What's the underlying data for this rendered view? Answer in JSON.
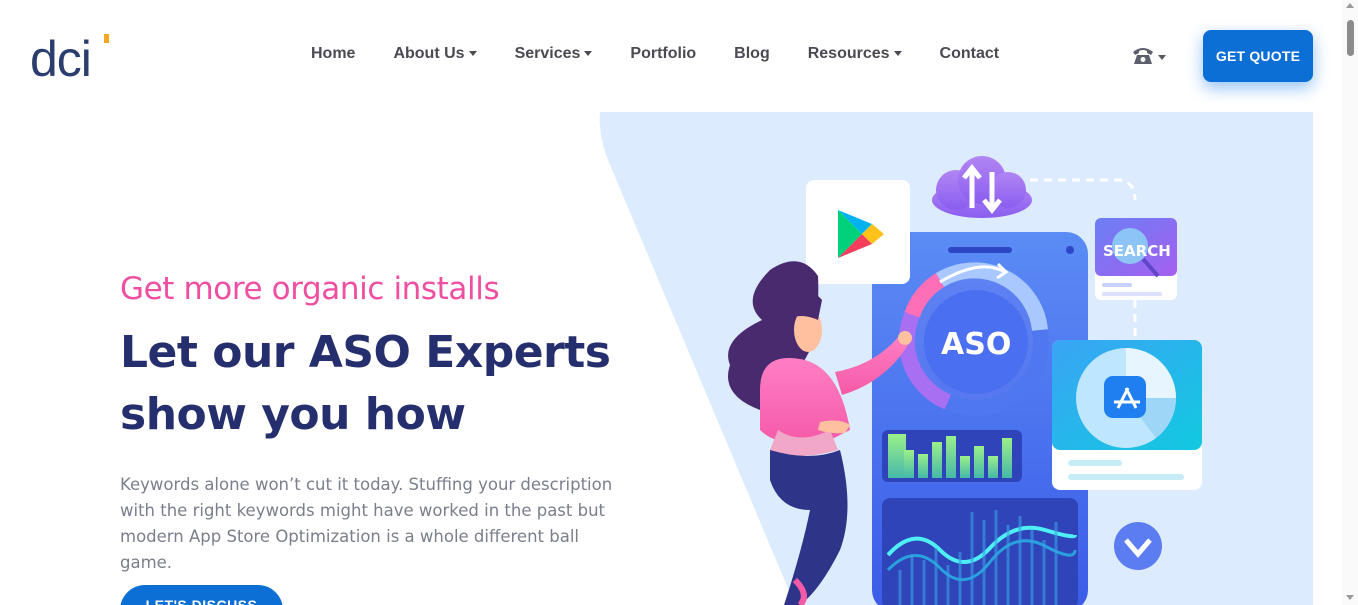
{
  "header": {
    "logo_text": "dci",
    "nav": [
      {
        "label": "Home",
        "has_dropdown": false
      },
      {
        "label": "About Us",
        "has_dropdown": true
      },
      {
        "label": "Services",
        "has_dropdown": true
      },
      {
        "label": "Portfolio",
        "has_dropdown": false
      },
      {
        "label": "Blog",
        "has_dropdown": false
      },
      {
        "label": "Resources",
        "has_dropdown": true
      },
      {
        "label": "Contact",
        "has_dropdown": false
      }
    ],
    "phone_icon": "telephone-icon",
    "quote_label": "GET QUOTE"
  },
  "hero": {
    "eyebrow": "Get more organic installs",
    "headline": "Let our ASO Experts show you how",
    "description": "Keywords alone won’t cut it today. Stuffing your description with the right keywords might have worked in the past but modern App Store Optimization is a whole different ball game.",
    "cta_label": "LET'S DISCUSS"
  },
  "illustration": {
    "aso_label": "ASO",
    "search_label": "SEARCH",
    "icons": [
      "google-play-icon",
      "cloud-sync-icon",
      "search-card-icon",
      "app-store-icon",
      "chevron-down-icon"
    ]
  },
  "colors": {
    "primary_blue": "#0c6fd6",
    "headline_navy": "#262f6e",
    "eyebrow_pink": "#ef4fa1",
    "hero_panel": "#dcebfd"
  }
}
